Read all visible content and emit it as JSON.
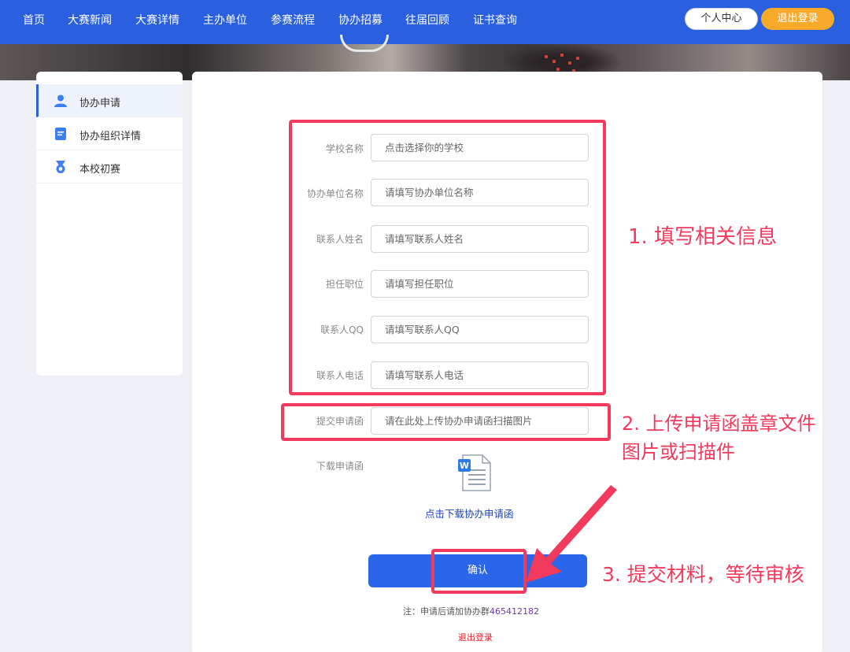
{
  "nav": {
    "items": [
      "首页",
      "大赛新闻",
      "大赛详情",
      "主办单位",
      "参赛流程",
      "协办招募",
      "往届回顾",
      "证书查询"
    ],
    "user_center": "个人中心",
    "logout": "退出登录"
  },
  "sidebar": {
    "items": [
      {
        "label": "协办申请",
        "icon": "user-icon",
        "active": true
      },
      {
        "label": "协办组织详情",
        "icon": "document-icon",
        "active": false
      },
      {
        "label": "本校初赛",
        "icon": "medal-icon",
        "active": false
      }
    ]
  },
  "form": {
    "fields": [
      {
        "label": "学校名称",
        "placeholder": "点击选择你的学校"
      },
      {
        "label": "协办单位名称",
        "placeholder": "请填写协办单位名称"
      },
      {
        "label": "联系人姓名",
        "placeholder": "请填写联系人姓名"
      },
      {
        "label": "担任职位",
        "placeholder": "请填写担任职位"
      },
      {
        "label": "联系人QQ",
        "placeholder": "请填写联系人QQ"
      },
      {
        "label": "联系人电话",
        "placeholder": "请填写联系人电话"
      }
    ],
    "upload": {
      "label": "提交申请函",
      "placeholder": "请在此处上传协办申请函扫描图片"
    },
    "download": {
      "label": "下载申请函",
      "link_text": "点击下载协办申请函"
    },
    "confirm": "确认",
    "note_prefix": "注：申请后请加协办群",
    "note_number": "465412182",
    "logout_link": "退出登录"
  },
  "annotations": {
    "step1": "1. 填写相关信息",
    "step2_line1": "2. 上传申请函盖章文件",
    "step2_line2": "图片或扫描件",
    "step3": "3. 提交材料，等待审核"
  },
  "colors": {
    "nav_bg": "#2a5fe0",
    "logout_btn": "#f7a92a",
    "confirm_btn": "#2a66ea",
    "annotation": "#f23a5c"
  }
}
